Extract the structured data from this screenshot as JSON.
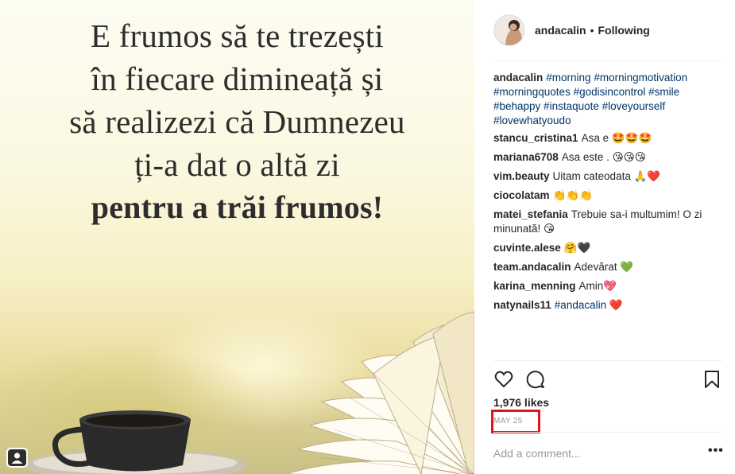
{
  "post": {
    "image_quote": {
      "lines": [
        "E frumos să te trezești",
        "în fiecare dimineață și",
        "să realizezi că Dumnezeu",
        "ți-a dat o altă zi",
        "pentru a trăi frumos!"
      ]
    },
    "author": {
      "username": "andacalin",
      "separator": "•",
      "follow_status": "Following"
    },
    "caption": {
      "username": "andacalin",
      "text": "#morning #morningmotivation #morningquotes #godisincontrol #smile #behappy #instaquote #loveyourself #lovewhatyoudo"
    },
    "comments": [
      {
        "username": "stancu_cristina1",
        "text": "Asa e 🤩🤩🤩"
      },
      {
        "username": "mariana6708",
        "text": "Asa este . 😘😘😘"
      },
      {
        "username": "vim.beauty",
        "text": "Uitam cateodata 🙏❤️"
      },
      {
        "username": "ciocolatam",
        "text": "👏👏👏"
      },
      {
        "username": "matei_stefania",
        "text": "Trebuie sa-i multumim! O zi minunată! 😘"
      },
      {
        "username": "cuvinte.alese",
        "text": "🤗🖤"
      },
      {
        "username": "team.andacalin",
        "text": "Adevărat 💚"
      },
      {
        "username": "karina_menning",
        "text": "Amin💖"
      },
      {
        "username": "natynails11",
        "text": "#andacalin ❤️"
      }
    ],
    "likes": "1,976 likes",
    "date": "MAY 25",
    "add_comment_placeholder": "Add a comment...",
    "more_label": "•••",
    "icons": {
      "like": "heart-icon",
      "comment": "comment-icon",
      "save": "bookmark-icon",
      "tagged": "user-tag-icon"
    },
    "colors": {
      "hashtag": "#003569",
      "highlight_box": "#e0151b",
      "date_text": "#999999"
    }
  }
}
